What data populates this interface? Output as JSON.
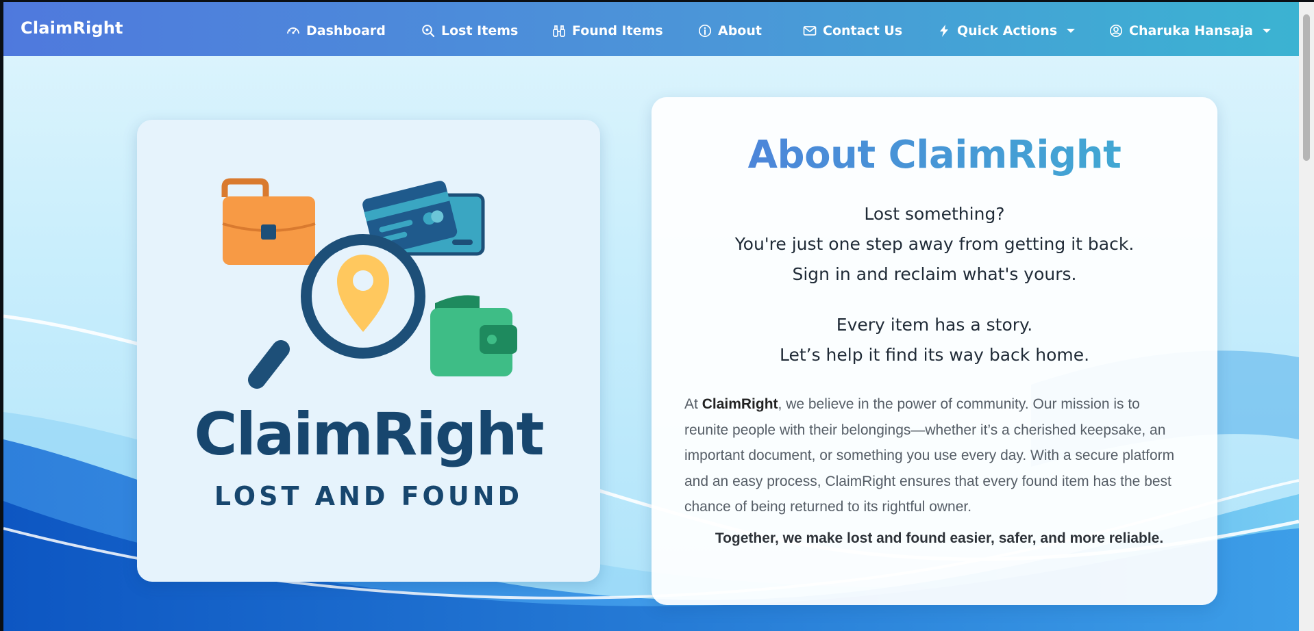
{
  "brand": "ClaimRight",
  "nav": {
    "dashboard": "Dashboard",
    "lost_items": "Lost Items",
    "found_items": "Found Items",
    "about": "About",
    "contact": "Contact Us",
    "quick_actions": "Quick Actions",
    "user": "Charuka Hansaja"
  },
  "logo": {
    "title": "ClaimRight",
    "subtitle": "LOST AND FOUND"
  },
  "about": {
    "title": "About ClaimRight",
    "tagline_1": "Lost something?",
    "tagline_2": "You're just one step away from getting it back.",
    "tagline_3": "Sign in and reclaim what's yours.",
    "tagline_4": "Every item has a story.",
    "tagline_5": "Let’s help it find its way back home.",
    "body_prefix": "At ",
    "body_brand": "ClaimRight",
    "body_rest": ", we believe in the power of community. Our mission is to reunite people with their belongings—whether it’s a cherished keepsake, an important document, or something you use every day. With a secure platform and an easy process, ClaimRight ensures that every found item has the best chance of being returned to its rightful owner.",
    "closing": "Together, we make lost and found easier, safer, and more reliable."
  },
  "colors": {
    "nav_start": "#4f79dd",
    "nav_end": "#3bb3d2",
    "logo_navy": "#17466e",
    "title_gradient_start": "#4f7ddb",
    "title_gradient_end": "#3fb0d1"
  },
  "icons": [
    "dashboard-gauge-icon",
    "search-icon",
    "binoculars-icon",
    "info-icon",
    "envelope-icon",
    "lightning-icon",
    "user-circle-icon",
    "chevron-down-icon"
  ]
}
